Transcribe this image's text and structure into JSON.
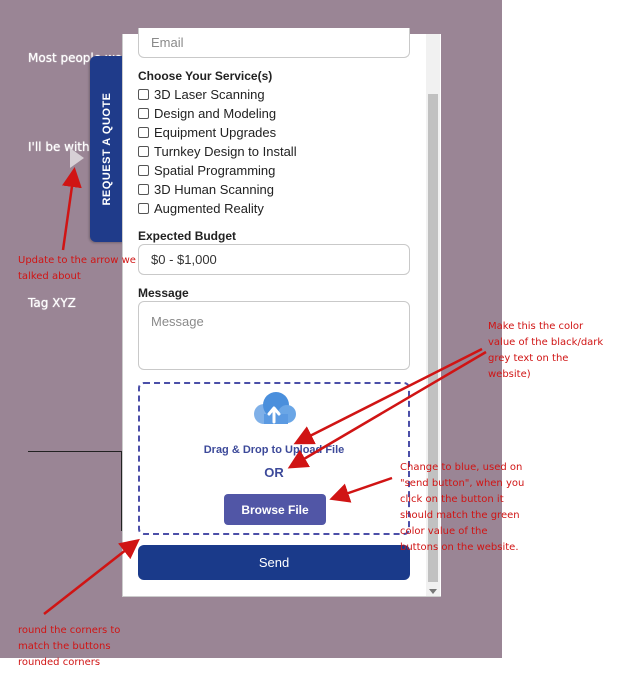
{
  "background": {
    "line1": "Most people wor",
    "line2": "I'll be with",
    "line3": "Tag XYZ"
  },
  "quote_tab": {
    "label": "REQUEST A QUOTE"
  },
  "form": {
    "email_placeholder": "Email",
    "services_label": "Choose Your Service(s)",
    "services": [
      "3D Laser Scanning",
      "Design and Modeling",
      "Equipment Upgrades",
      "Turnkey Design to Install",
      "Spatial Programming",
      "3D Human Scanning",
      "Augmented Reality"
    ],
    "budget_label": "Expected Budget",
    "budget_value": "$0 - $1,000",
    "message_label": "Message",
    "message_placeholder": "Message",
    "upload": {
      "drag_text": "Drag & Drop to Upload File",
      "or_text": "OR",
      "browse_label": "Browse File"
    },
    "send_label": "Send"
  },
  "annotations": {
    "arrow_note": [
      "Update to the arrow we",
      "talked about"
    ],
    "color_note": [
      "Make this the color",
      "value of the black/dark",
      "grey text on the",
      "website)"
    ],
    "blue_note": [
      "Change to blue, used on",
      "\"send button\", when you",
      "click on the button it",
      "should match the green",
      "color value of the",
      "buttons on the website."
    ],
    "corners_note": [
      "round the corners to",
      "match the buttons",
      "rounded corners"
    ]
  },
  "colors": {
    "tab_blue": "#1f3b8a",
    "send_blue": "#1a3a8a",
    "browse_purple": "#5156a6",
    "annotation_red": "#d01414",
    "background": "#9a8595"
  }
}
